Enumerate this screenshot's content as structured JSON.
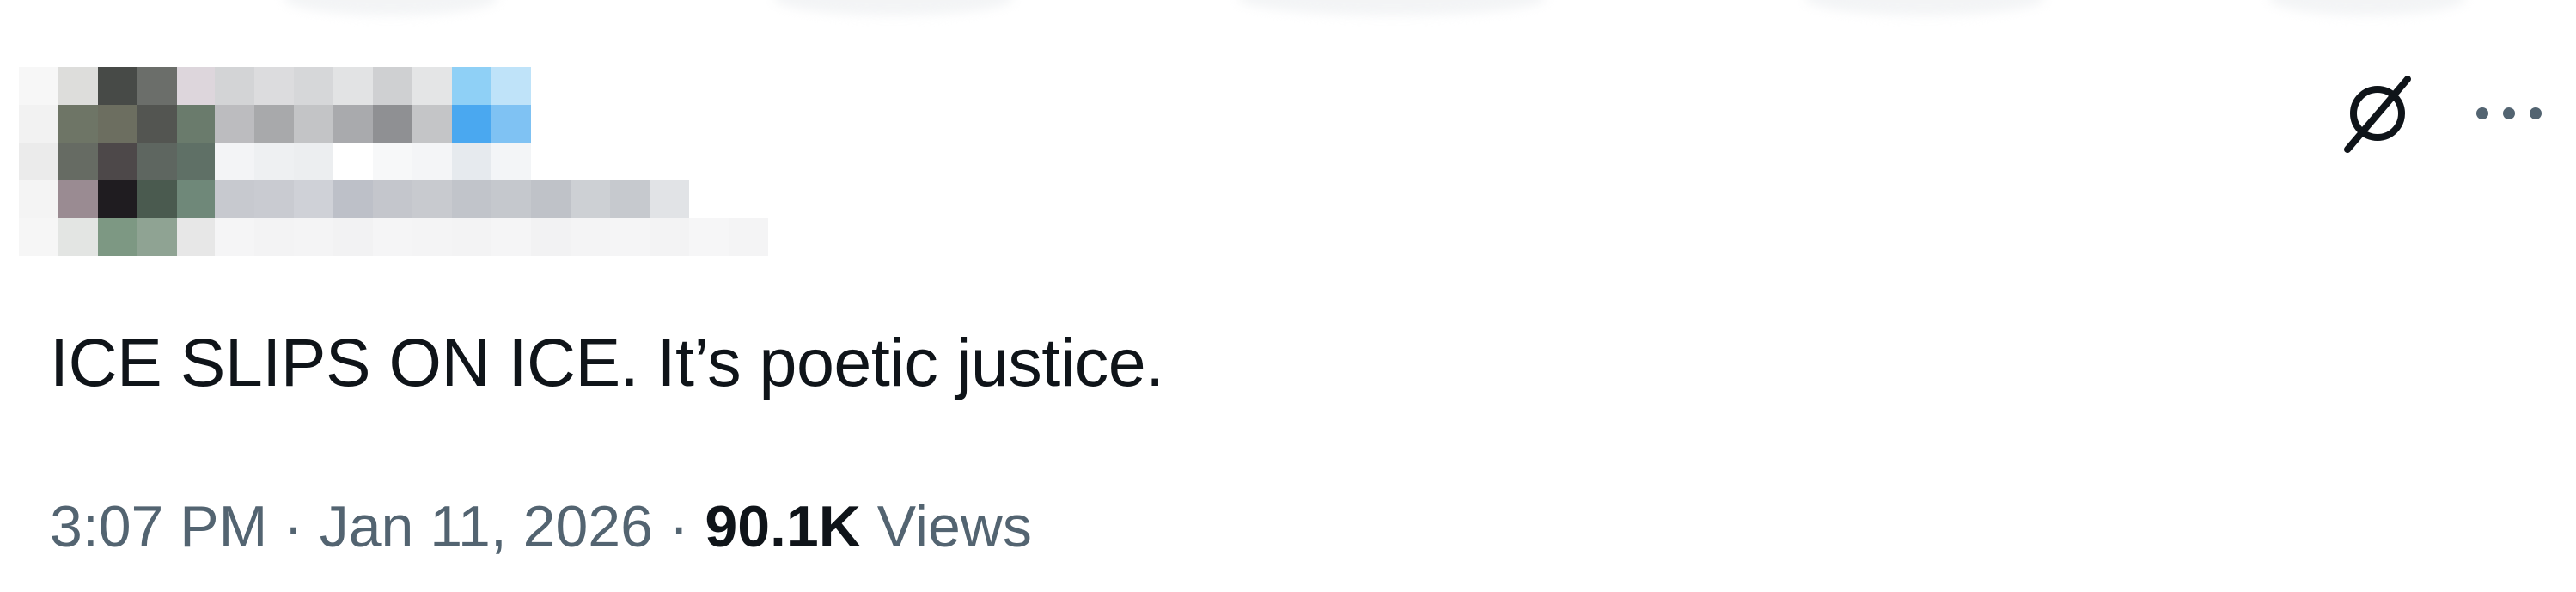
{
  "tweet": {
    "text": "ICE SLIPS ON ICE. It’s poetic justice.",
    "time": "3:07 PM",
    "separator": "·",
    "date": "Jan 11, 2026",
    "views_count": "90.1K",
    "views_label": "Views"
  },
  "icons": {
    "grok": "grok-icon",
    "more": "more-options-icon"
  },
  "colors": {
    "text_primary": "#0f1419",
    "text_secondary": "#536471",
    "background": "#ffffff",
    "verified_blue": "#4aa8f0"
  }
}
